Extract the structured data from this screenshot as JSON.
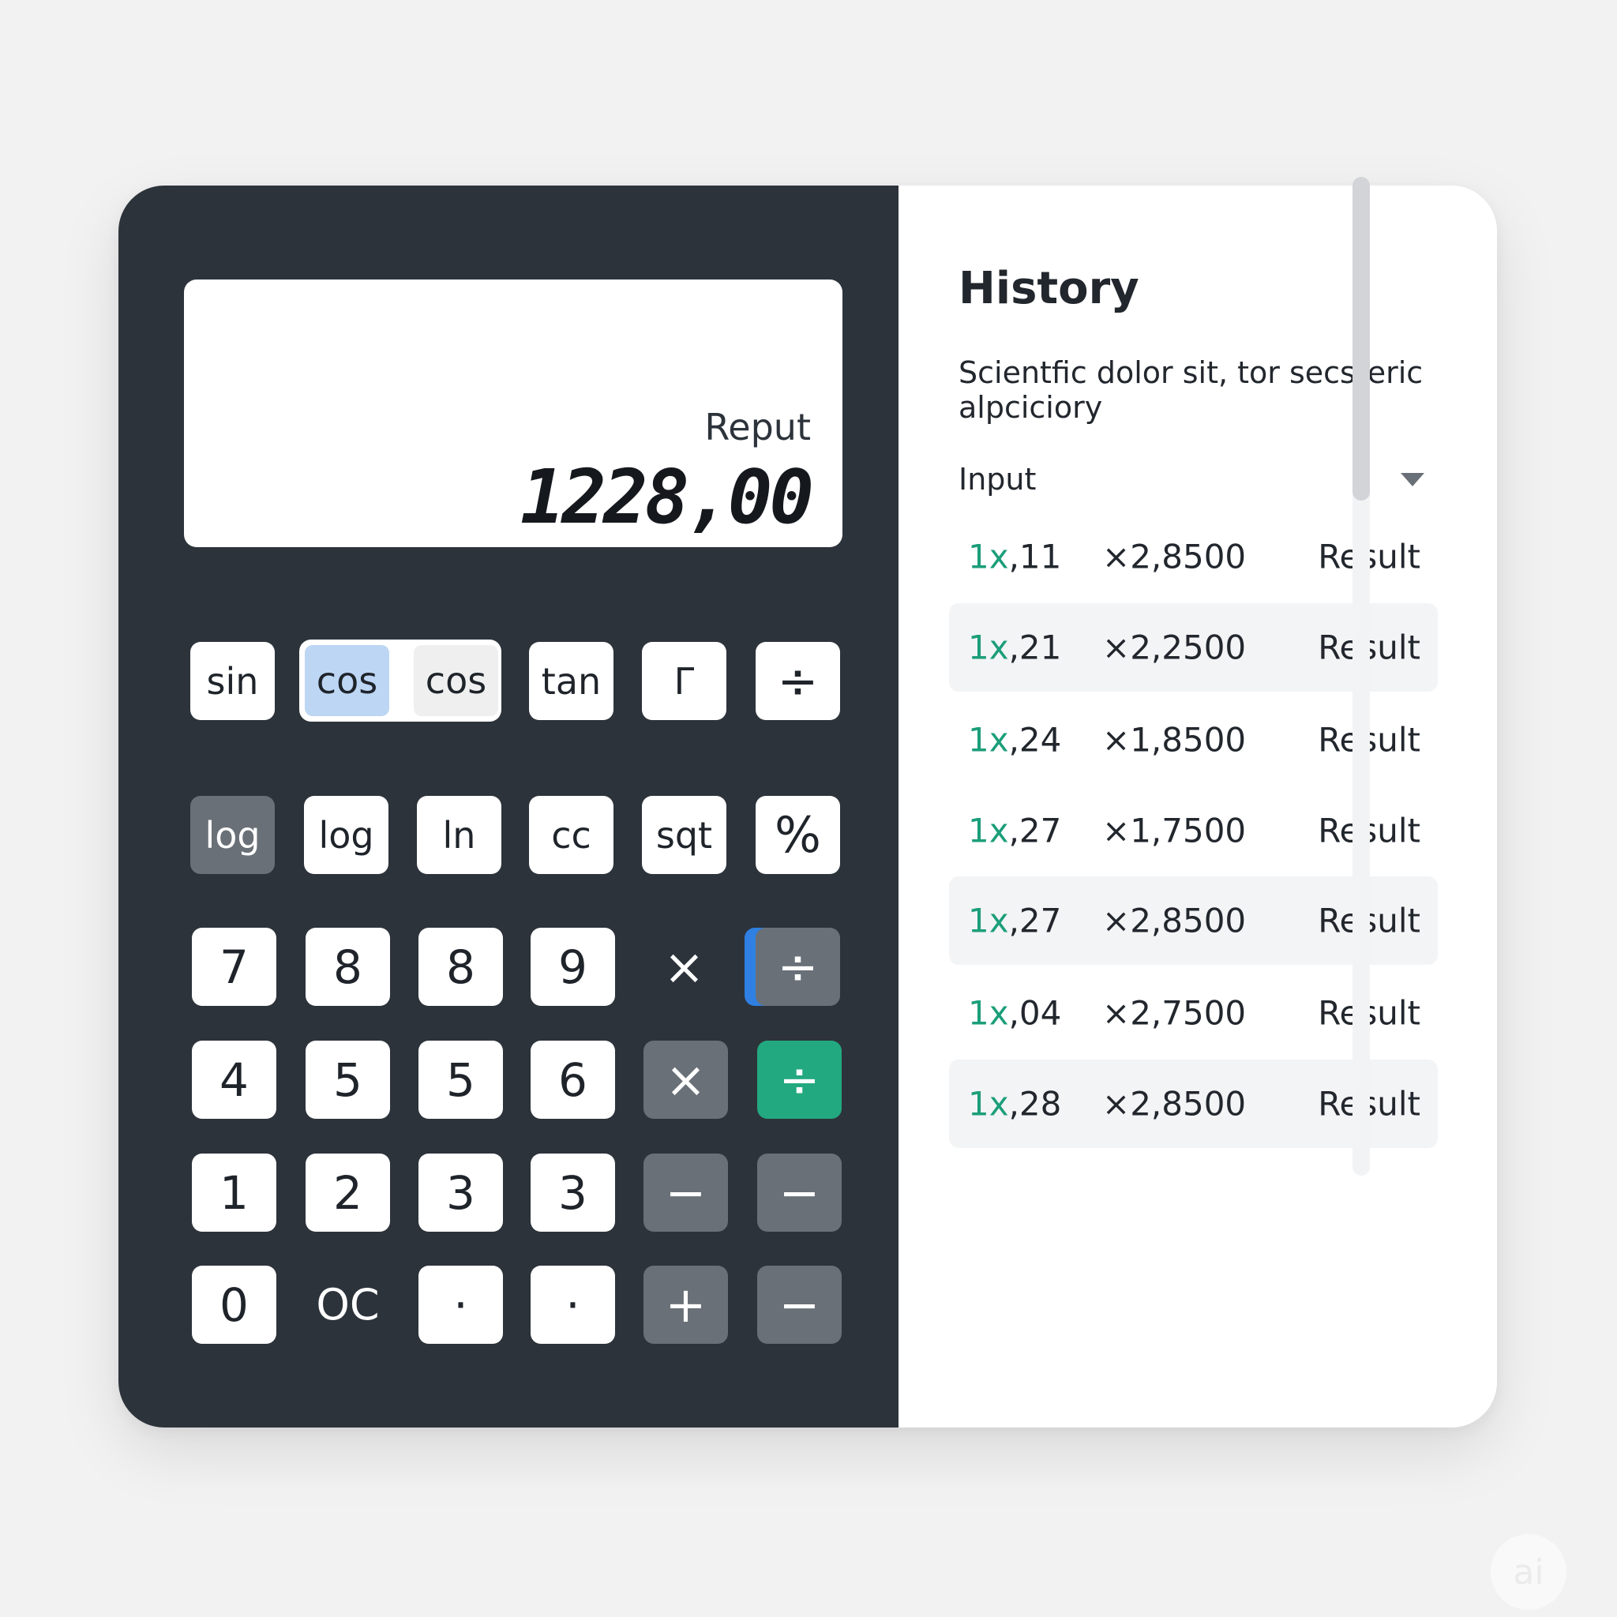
{
  "display": {
    "label": "Reput",
    "value": "1228,00"
  },
  "keypad": {
    "row1": {
      "k1": "sin",
      "k2a": "cos",
      "k2b": "cos",
      "k3": "tan",
      "k4": "Γ",
      "k5": "÷"
    },
    "row2": {
      "k0": "log",
      "k1": "log",
      "k2": "ln",
      "k3": "cc",
      "k4": "sqt",
      "k5": "%"
    },
    "row3": {
      "k0": "7",
      "k1": "8",
      "k2": "8",
      "k3": "9",
      "k4": "×",
      "k5": "÷"
    },
    "row4": {
      "k0": "4",
      "k1": "5",
      "k2": "5",
      "k3": "6",
      "k4": "×",
      "k5": "÷"
    },
    "row5": {
      "k0": "1",
      "k1": "2",
      "k2": "3",
      "k3": "3",
      "k4": "−",
      "k5": "−"
    },
    "row6": {
      "k0": "0",
      "k1": "OC",
      "k2": "·",
      "k3": "·",
      "k4": "+",
      "k5": "−"
    }
  },
  "history": {
    "title": "History",
    "description": "Scientfic dolor sit, tor secsteric alpciciory",
    "input_label": "Input",
    "rows": [
      {
        "prefix": "1x",
        "input": ",11",
        "value": "×2,8500",
        "result": "Result"
      },
      {
        "prefix": "1x",
        "input": ",21",
        "value": "×2,2500",
        "result": "Result"
      },
      {
        "prefix": "1x",
        "input": ",24",
        "value": "×1,8500",
        "result": "Result"
      },
      {
        "prefix": "1x",
        "input": ",27",
        "value": "×1,7500",
        "result": "Result"
      },
      {
        "prefix": "1x",
        "input": ",27",
        "value": "×2,8500",
        "result": "Result"
      },
      {
        "prefix": "1x",
        "input": ",04",
        "value": "×2,7500",
        "result": "Result"
      },
      {
        "prefix": "1x",
        "input": ",28",
        "value": "×2,8500",
        "result": "Result"
      }
    ]
  },
  "badge": {
    "text": "ai"
  },
  "colors": {
    "panel_dark": "#2d333b",
    "accent_green": "#23a97f",
    "accent_blue": "#2f80e2",
    "key_dark": "#6a7077"
  }
}
